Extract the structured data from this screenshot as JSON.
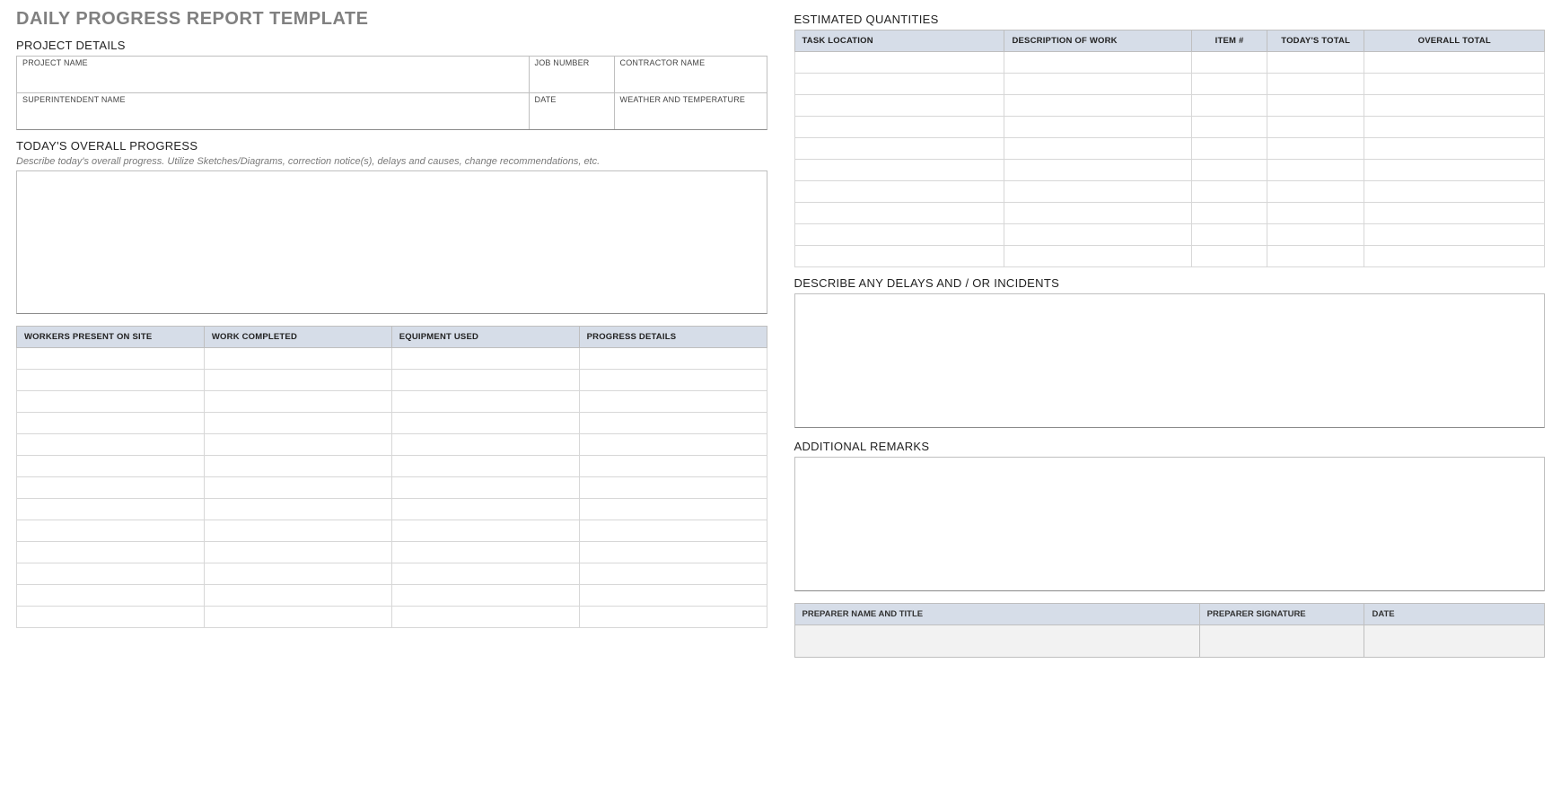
{
  "title": "DAILY PROGRESS REPORT TEMPLATE",
  "project_details": {
    "heading": "PROJECT DETAILS",
    "labels": {
      "project_name": "PROJECT NAME",
      "job_number": "JOB NUMBER",
      "contractor_name": "CONTRACTOR NAME",
      "superintendent_name": "SUPERINTENDENT NAME",
      "date": "DATE",
      "weather": "WEATHER AND TEMPERATURE"
    },
    "values": {
      "project_name": "",
      "job_number": "",
      "contractor_name": "",
      "superintendent_name": "",
      "date": "",
      "weather": ""
    }
  },
  "overall_progress": {
    "heading": "TODAY'S OVERALL PROGRESS",
    "hint": "Describe today's overall progress.  Utilize Sketches/Diagrams, correction notice(s), delays and causes, change recommendations, etc.",
    "value": ""
  },
  "progress_table": {
    "headers": [
      "WORKERS PRESENT ON SITE",
      "WORK COMPLETED",
      "EQUIPMENT USED",
      "PROGRESS DETAILS"
    ],
    "rows": [
      [
        "",
        "",
        "",
        ""
      ],
      [
        "",
        "",
        "",
        ""
      ],
      [
        "",
        "",
        "",
        ""
      ],
      [
        "",
        "",
        "",
        ""
      ],
      [
        "",
        "",
        "",
        ""
      ],
      [
        "",
        "",
        "",
        ""
      ],
      [
        "",
        "",
        "",
        ""
      ],
      [
        "",
        "",
        "",
        ""
      ],
      [
        "",
        "",
        "",
        ""
      ],
      [
        "",
        "",
        "",
        ""
      ],
      [
        "",
        "",
        "",
        ""
      ],
      [
        "",
        "",
        "",
        ""
      ],
      [
        "",
        "",
        "",
        ""
      ]
    ]
  },
  "estimated_quantities": {
    "heading": "ESTIMATED QUANTITIES",
    "headers": [
      "TASK LOCATION",
      "DESCRIPTION OF WORK",
      "ITEM #",
      "TODAY'S TOTAL",
      "OVERALL TOTAL"
    ],
    "rows": [
      [
        "",
        "",
        "",
        "",
        ""
      ],
      [
        "",
        "",
        "",
        "",
        ""
      ],
      [
        "",
        "",
        "",
        "",
        ""
      ],
      [
        "",
        "",
        "",
        "",
        ""
      ],
      [
        "",
        "",
        "",
        "",
        ""
      ],
      [
        "",
        "",
        "",
        "",
        ""
      ],
      [
        "",
        "",
        "",
        "",
        ""
      ],
      [
        "",
        "",
        "",
        "",
        ""
      ],
      [
        "",
        "",
        "",
        "",
        ""
      ],
      [
        "",
        "",
        "",
        "",
        ""
      ]
    ]
  },
  "delays": {
    "heading": "DESCRIBE ANY DELAYS AND / OR INCIDENTS",
    "value": ""
  },
  "remarks": {
    "heading": "ADDITIONAL REMARKS",
    "value": ""
  },
  "signoff": {
    "headers": [
      "PREPARER NAME AND TITLE",
      "PREPARER SIGNATURE",
      "DATE"
    ],
    "values": {
      "name": "",
      "signature": "",
      "date": ""
    }
  }
}
